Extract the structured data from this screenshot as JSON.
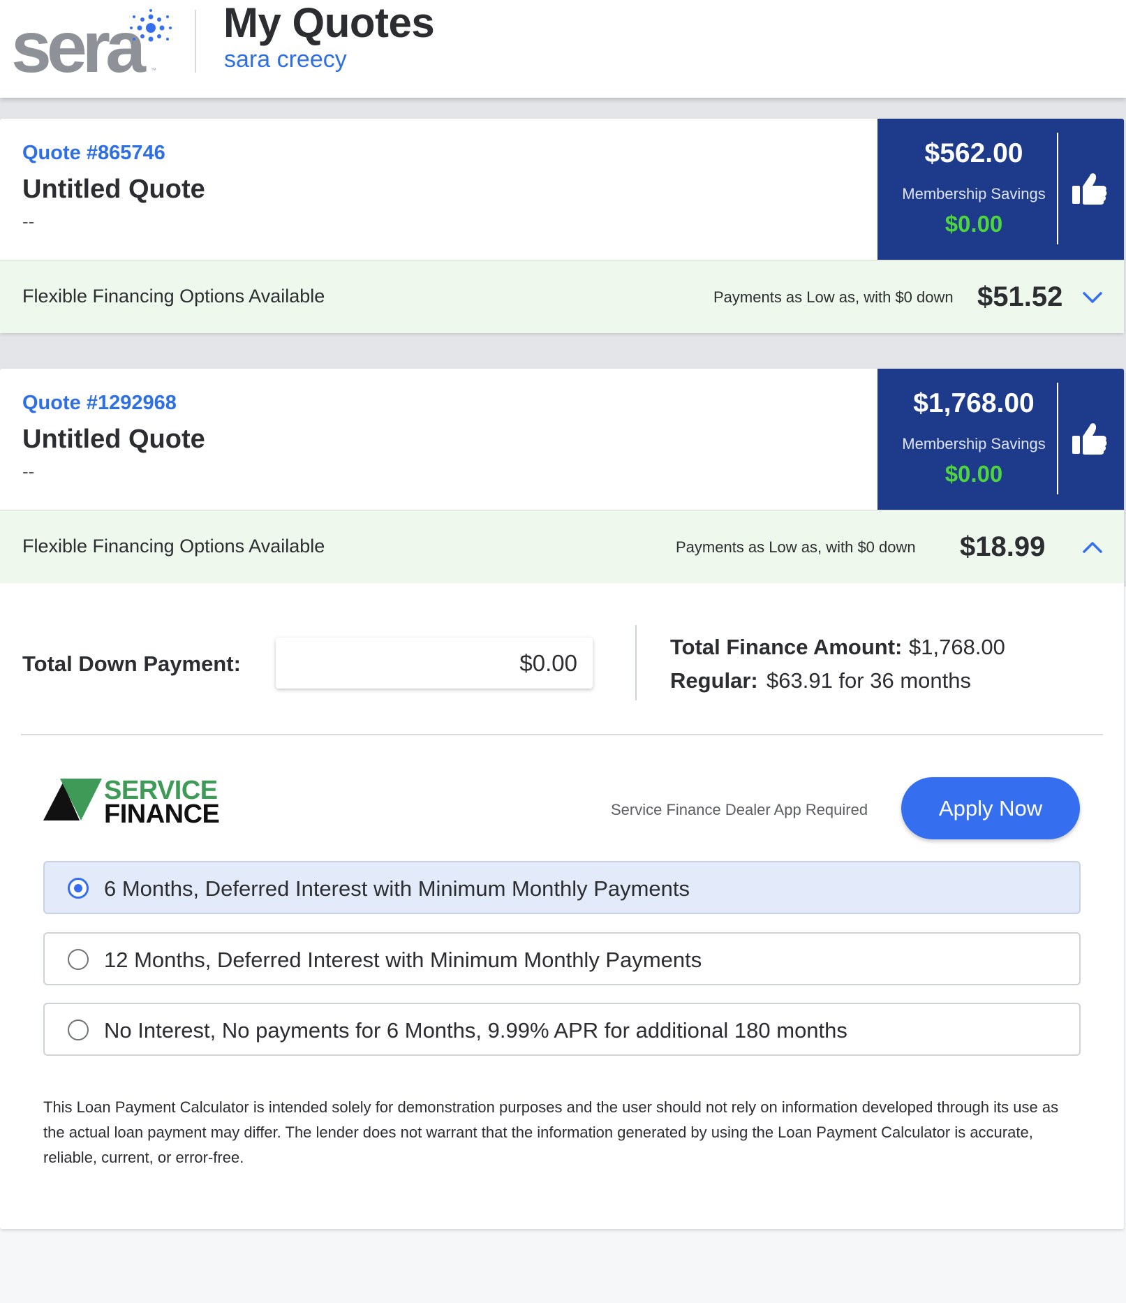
{
  "header": {
    "logo_text": "sera",
    "logo_tm": "™",
    "title": "My Quotes",
    "user_name": "sara creecy"
  },
  "colors": {
    "brand_blue": "#2f6fe6",
    "price_panel": "#1e3a8a",
    "savings_green": "#4ed43f",
    "financing_bg": "#eef8ec",
    "apply_button": "#356ff0"
  },
  "quotes": [
    {
      "number": "Quote #865746",
      "name": "Untitled Quote",
      "description": "--",
      "price": "$562.00",
      "savings_label": "Membership Savings",
      "savings": "$0.00",
      "approve_icon": "thumbs-up-icon",
      "financing": {
        "label": "Flexible Financing Options Available",
        "payments_text": "Payments as Low as, with $0 down",
        "amount": "$51.52",
        "expanded": false,
        "toggle_icon": "chevron-down-icon"
      }
    },
    {
      "number": "Quote #1292968",
      "name": "Untitled Quote",
      "description": "--",
      "price": "$1,768.00",
      "savings_label": "Membership Savings",
      "savings": "$0.00",
      "approve_icon": "thumbs-up-icon",
      "financing": {
        "label": "Flexible Financing Options Available",
        "payments_text": "Payments as Low as, with $0 down",
        "amount": "$18.99",
        "expanded": true,
        "toggle_icon": "chevron-up-icon"
      }
    }
  ],
  "calculator": {
    "down_payment_label": "Total Down Payment:",
    "down_payment_value": "$0.00",
    "total_finance_label": "Total Finance Amount:",
    "total_finance_value": "$1,768.00",
    "regular_label": "Regular:",
    "regular_value": "$63.91 for 36 months",
    "lender": {
      "logo_line1": "SERVICE",
      "logo_line2": "FINANCE",
      "note": "Service Finance Dealer App Required",
      "apply_label": "Apply Now"
    },
    "options": [
      {
        "label": "6 Months, Deferred Interest with Minimum Monthly Payments",
        "selected": true
      },
      {
        "label": "12 Months, Deferred Interest with Minimum Monthly Payments",
        "selected": false
      },
      {
        "label": "No Interest, No payments for 6 Months, 9.99% APR for additional 180 months",
        "selected": false
      }
    ],
    "disclaimer": "This Loan Payment Calculator is intended solely for demonstration purposes and the user should not rely on information developed through its use as the actual loan payment may differ. The lender does not warrant that the information generated by using the Loan Payment Calculator is accurate, reliable, current, or error-free."
  }
}
